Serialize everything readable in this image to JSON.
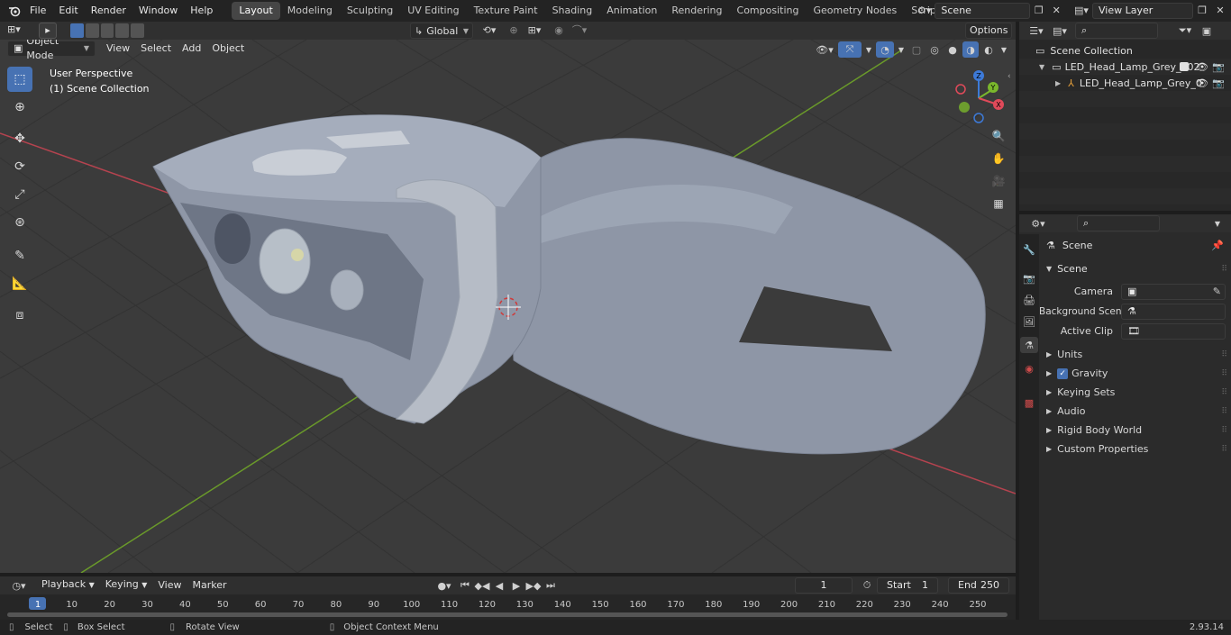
{
  "topbar": {
    "menus": [
      "File",
      "Edit",
      "Render",
      "Window",
      "Help"
    ],
    "workspaces": [
      "Layout",
      "Modeling",
      "Sculpting",
      "UV Editing",
      "Texture Paint",
      "Shading",
      "Animation",
      "Rendering",
      "Compositing",
      "Geometry Nodes",
      "Scripting"
    ],
    "active_workspace": "Layout",
    "add_tab": "+",
    "scene_name": "Scene",
    "view_layer": "View Layer"
  },
  "viewport_header": {
    "mode": "Object Mode",
    "view": "View",
    "select": "Select",
    "add": "Add",
    "object": "Object",
    "transform_orientation": "Global",
    "options": "Options"
  },
  "viewport": {
    "perspective_label": "User Perspective",
    "collection_label": "(1) Scene Collection",
    "gizmo": {
      "z": "Z",
      "y": "Y",
      "x": "X"
    }
  },
  "outliner": {
    "root": "Scene Collection",
    "items": [
      {
        "label": "LED_Head_Lamp_Grey_002"
      },
      {
        "label": "LED_Head_Lamp_Grey_0"
      }
    ]
  },
  "properties": {
    "context": "Scene",
    "panel_title": "Scene",
    "fields": [
      {
        "label": "Camera"
      },
      {
        "label": "Background Scene"
      },
      {
        "label": "Active Clip"
      }
    ],
    "subpanels": [
      "Units",
      "Gravity",
      "Keying Sets",
      "Audio",
      "Rigid Body World",
      "Custom Properties"
    ],
    "gravity_checked": true
  },
  "timeline": {
    "playback": "Playback",
    "keying": "Keying",
    "view": "View",
    "marker": "Marker",
    "current_frame": "1",
    "start_label": "Start",
    "start_value": "1",
    "end_label": "End",
    "end_value": "250",
    "ticks": [
      "1",
      "10",
      "20",
      "30",
      "40",
      "50",
      "60",
      "70",
      "80",
      "90",
      "100",
      "110",
      "120",
      "130",
      "140",
      "150",
      "160",
      "170",
      "180",
      "190",
      "200",
      "210",
      "220",
      "230",
      "240",
      "250"
    ]
  },
  "statusbar": {
    "select": "Select",
    "box_select": "Box Select",
    "rotate_view": "Rotate View",
    "context_menu": "Object Context Menu",
    "version": "2.93.14"
  },
  "colors": {
    "accent": "#4772b3",
    "axis_x": "#e04a5a",
    "axis_y": "#7ab72c",
    "axis_z": "#3d7ad8"
  }
}
